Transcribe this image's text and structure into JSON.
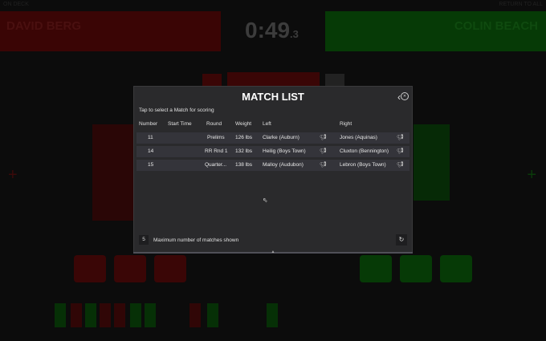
{
  "topbar": {
    "left": "ON DECK",
    "right": "RETURN TO ALL"
  },
  "scoreboard": {
    "left_name": "DAVID BERG",
    "right_name": "COLIN BEACH",
    "clock_main": "0:49",
    "clock_fraction": ".3"
  },
  "modal": {
    "title": "MATCH LIST",
    "subtitle": "Tap to select a Match for scoring",
    "columns": [
      "Number",
      "Start Time",
      "Round",
      "Weight",
      "Left",
      "Right"
    ],
    "rows": [
      {
        "number": "11",
        "start_time": "",
        "round": "Prelims",
        "weight": "126 lbs",
        "left": "Clarke (Auburn)",
        "right": "Jones (Aquinas)"
      },
      {
        "number": "14",
        "start_time": "",
        "round": "RR Rnd 1",
        "weight": "132 lbs",
        "left": "Heilig (Boys Town)",
        "right": "Cluxton (Bennington)"
      },
      {
        "number": "15",
        "start_time": "",
        "round": "Quarter...",
        "weight": "138 lbs",
        "left": "Malloy (Audubon)",
        "right": "Lebron (Boys Town)"
      }
    ],
    "max_matches": "5",
    "max_matches_label": "Maximum number of matches shown"
  },
  "icons": {
    "back": "chevron-left-icon",
    "close": "close-circle-icon",
    "announce": "megaphone-icon",
    "refresh": "refresh-icon"
  },
  "colors": {
    "left_team": "#3a0505",
    "right_team": "#063a06",
    "modal_bg": "#2a2a2c",
    "row_bg": "#34343a"
  }
}
